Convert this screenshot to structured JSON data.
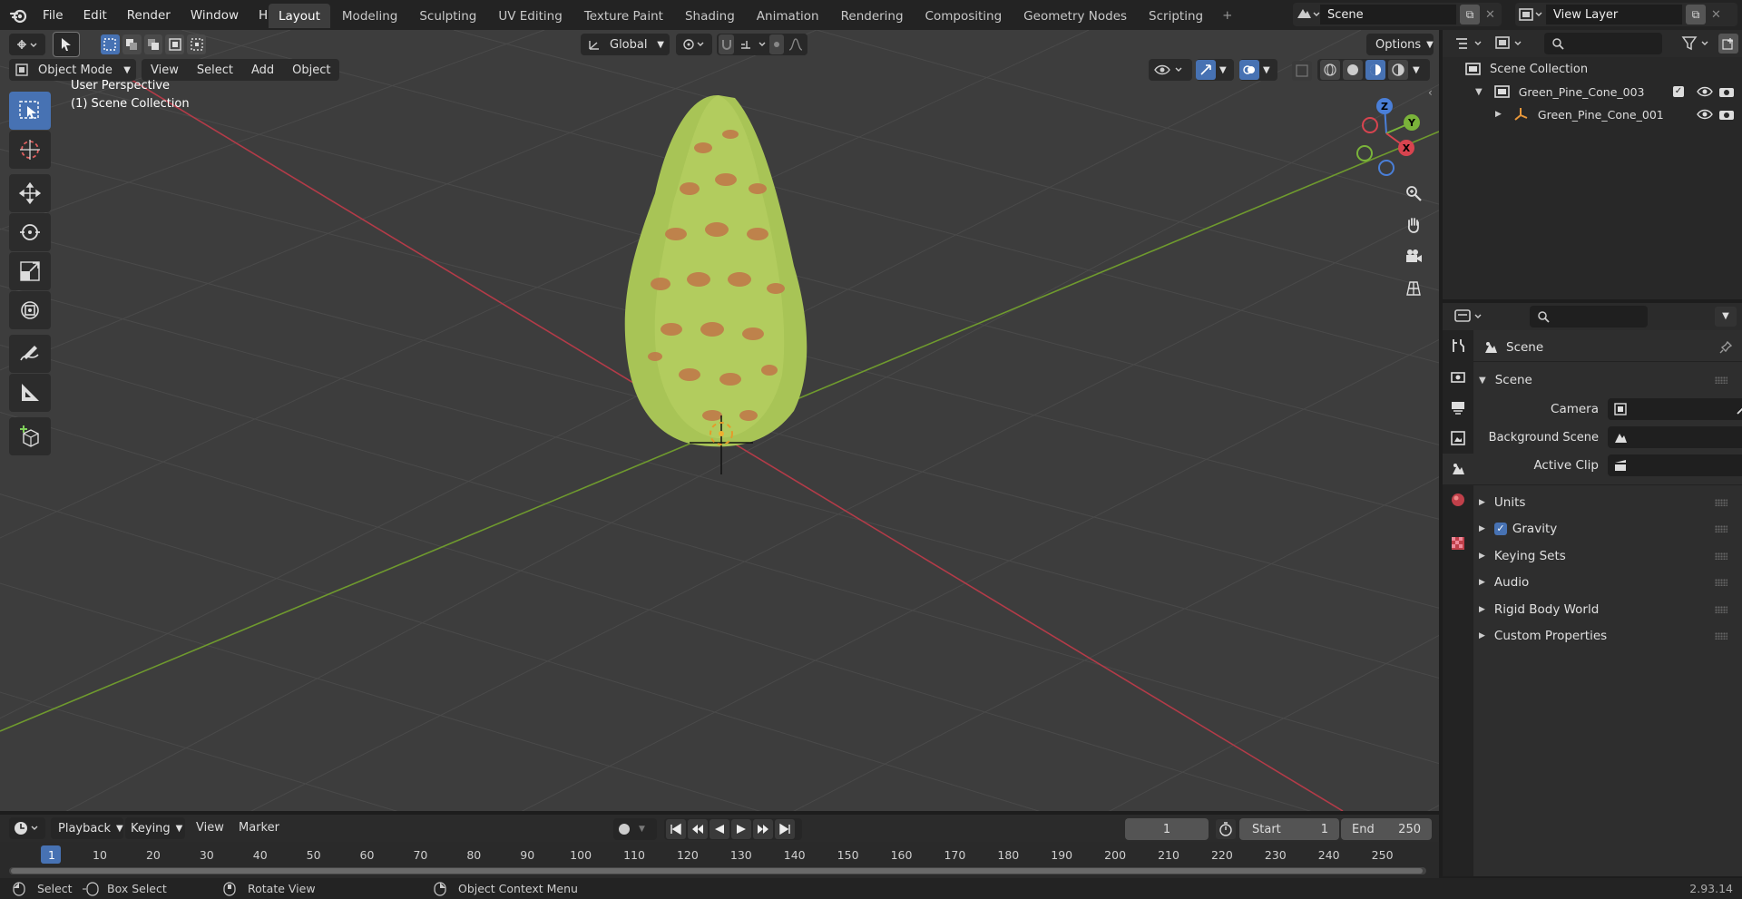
{
  "menu": [
    "File",
    "Edit",
    "Render",
    "Window",
    "Help"
  ],
  "workspaces": [
    "Layout",
    "Modeling",
    "Sculpting",
    "UV Editing",
    "Texture Paint",
    "Shading",
    "Animation",
    "Rendering",
    "Compositing",
    "Geometry Nodes",
    "Scripting"
  ],
  "active_workspace": "Layout",
  "scene_name": "Scene",
  "view_layer": "View Layer",
  "viewport": {
    "mode": "Object Mode",
    "menus": [
      "View",
      "Select",
      "Add",
      "Object"
    ],
    "transform_orientation": "Global",
    "options_label": "Options",
    "overlay_line1": "User Perspective",
    "overlay_line2": "(1) Scene Collection",
    "axes": {
      "z": "Z",
      "y": "Y",
      "x": "X"
    }
  },
  "outliner": {
    "root": "Scene Collection",
    "items": [
      {
        "label": "Green_Pine_Cone_003"
      },
      {
        "label": "Green_Pine_Cone_001"
      }
    ]
  },
  "properties": {
    "context": "Scene",
    "panel": "Scene",
    "fields": [
      {
        "label": "Camera"
      },
      {
        "label": "Background Scene"
      },
      {
        "label": "Active Clip"
      }
    ],
    "sections": [
      "Units",
      "Gravity",
      "Keying Sets",
      "Audio",
      "Rigid Body World",
      "Custom Properties"
    ],
    "gravity_checked": true
  },
  "timeline": {
    "menus": [
      "Playback",
      "Keying",
      "View",
      "Marker"
    ],
    "current_frame": "1",
    "start_label": "Start",
    "start": "1",
    "end_label": "End",
    "end": "250",
    "ticks": [
      "1",
      "10",
      "20",
      "30",
      "40",
      "50",
      "60",
      "70",
      "80",
      "90",
      "100",
      "110",
      "120",
      "130",
      "140",
      "150",
      "160",
      "170",
      "180",
      "190",
      "200",
      "210",
      "220",
      "230",
      "240",
      "250"
    ]
  },
  "status": {
    "select": "Select",
    "box_select": "Box Select",
    "rotate": "Rotate View",
    "context_menu": "Object Context Menu",
    "version": "2.93.14"
  }
}
